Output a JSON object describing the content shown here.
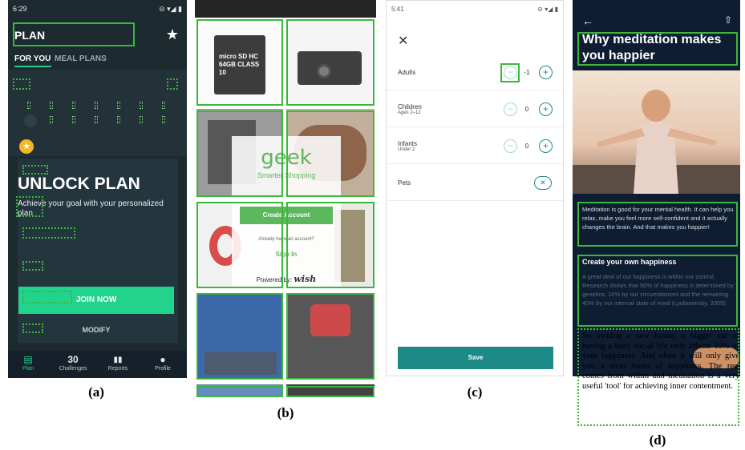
{
  "captions": [
    "(a)",
    "(b)",
    "(c)",
    "(d)"
  ],
  "panel_a": {
    "status_time": "6:29",
    "status_icons": "⊝ ▾◢ ▮",
    "title": "PLAN",
    "star_icon": "★",
    "tabs": [
      "FOR YOU",
      "MEAL PLANS"
    ],
    "unlock_title": "UNLOCK PLAN",
    "unlock_desc": "Achieve your goal with your personalized plan",
    "join_label": "JOIN NOW",
    "modify_label": "MODIFY",
    "nav": [
      {
        "icon": "▤",
        "label": "Plan"
      },
      {
        "icon": "30",
        "label": "Challenges"
      },
      {
        "icon": "▮▮",
        "label": "Reports"
      },
      {
        "icon": "●",
        "label": "Profile"
      }
    ],
    "accent_color": "#22d38d"
  },
  "panel_b": {
    "logo": "geek",
    "tagline": "Smarter Shopping",
    "create_label": "Create Account",
    "have_account": "Already have an account?",
    "signin_label": "Sign In",
    "powered_label": "Powered by:",
    "powered_brand": "wish",
    "memory_label": "micro SD HC 64GB CLASS 10",
    "accent_color": "#5cb85c"
  },
  "panel_c": {
    "status_time": "5:41",
    "status_icons": "⊝ ▾◢ ▮",
    "close_icon": "✕",
    "rows": [
      {
        "label": "Adults",
        "sub": "",
        "value": "-1"
      },
      {
        "label": "Children",
        "sub": "Ages 2–12",
        "value": "0"
      },
      {
        "label": "Infants",
        "sub": "Under 2",
        "value": "0"
      }
    ],
    "pets_label": "Pets",
    "minus": "−",
    "plus": "+",
    "toggle_icon": "✕",
    "save_label": "Save",
    "accent_color": "#1c8a86"
  },
  "panel_d": {
    "back_icon": "←",
    "share_icon": "⇧",
    "title": "Why meditation makes you happier",
    "para1": "Meditation is good for your mental health. It can help you relax, make you feel more self-confident and it actually changes the brain. And that makes you happier!",
    "heading2": "Create your own happiness",
    "para2": "A great deal of our happiness is within our control. Research shows that 50% of happiness is determined by genetics, 10% by our circumstances and the remaining 40% by our internal state of mind (Lyubomirsky, 2005).",
    "para3": "So owning a new house, a bigger car or having a busy social life only affects 10% of your happiness. And often it will only give you a short boost of happiness. The rest comes from within and meditation is a very useful 'tool' for achieving inner contentment."
  }
}
